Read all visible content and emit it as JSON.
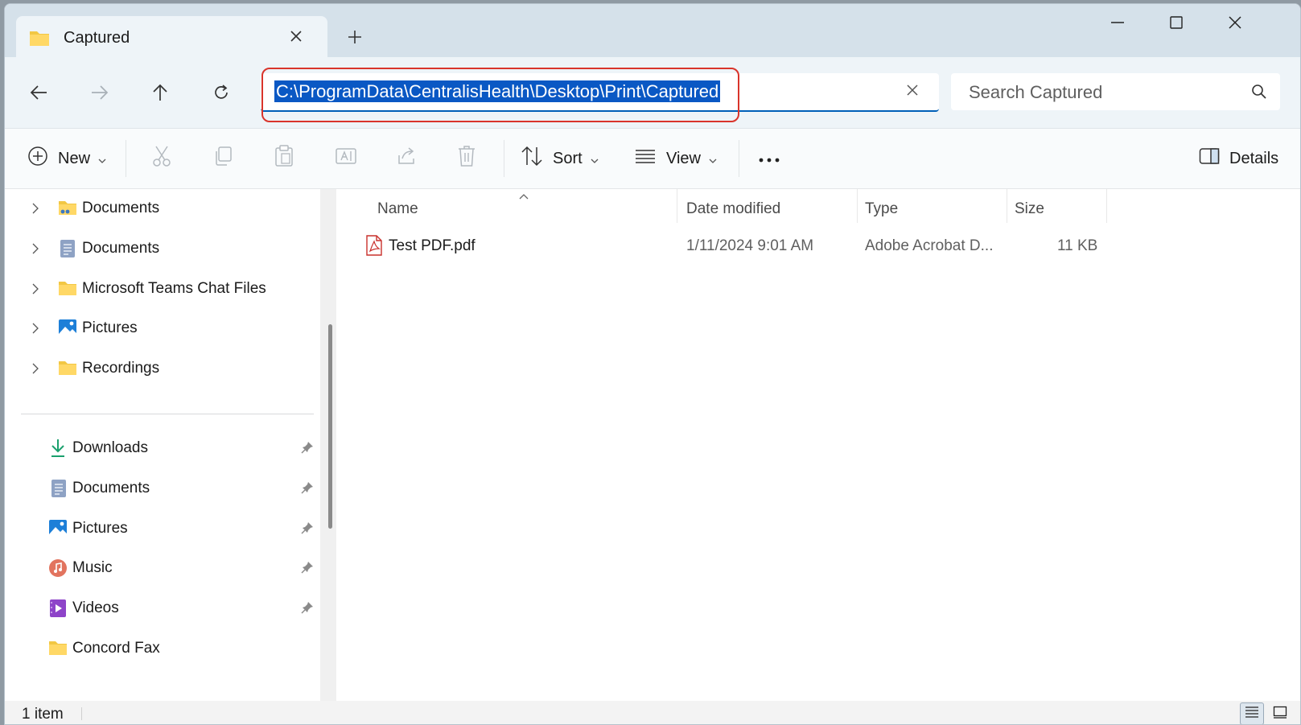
{
  "tab": {
    "title": "Captured"
  },
  "address": {
    "path": "C:\\ProgramData\\CentralisHealth\\Desktop\\Print\\Captured"
  },
  "search": {
    "placeholder": "Search Captured"
  },
  "commands": {
    "new_label": "New",
    "sort_label": "Sort",
    "view_label": "View",
    "details_label": "Details"
  },
  "nav": {
    "tree": [
      {
        "label": "Documents",
        "icon": "documents-network-folder-icon"
      },
      {
        "label": "Documents",
        "icon": "documents-icon"
      },
      {
        "label": "Microsoft Teams Chat Files",
        "icon": "folder-icon"
      },
      {
        "label": "Pictures",
        "icon": "pictures-icon"
      },
      {
        "label": "Recordings",
        "icon": "folder-icon"
      }
    ],
    "quick": [
      {
        "label": "Downloads",
        "icon": "download-icon"
      },
      {
        "label": "Documents",
        "icon": "documents-icon"
      },
      {
        "label": "Pictures",
        "icon": "pictures-icon"
      },
      {
        "label": "Music",
        "icon": "music-icon"
      },
      {
        "label": "Videos",
        "icon": "videos-icon"
      },
      {
        "label": "Concord Fax",
        "icon": "folder-icon"
      }
    ]
  },
  "columns": {
    "name": "Name",
    "date": "Date modified",
    "type": "Type",
    "size": "Size"
  },
  "files": [
    {
      "name": "Test PDF.pdf",
      "date": "1/11/2024 9:01 AM",
      "type": "Adobe Acrobat D...",
      "size": "11 KB",
      "icon": "pdf-file-icon"
    }
  ],
  "status": {
    "count": "1 item"
  },
  "colors": {
    "accent": "#005fb8",
    "highlight": "#0a58c4",
    "annotation": "#d9342b"
  }
}
